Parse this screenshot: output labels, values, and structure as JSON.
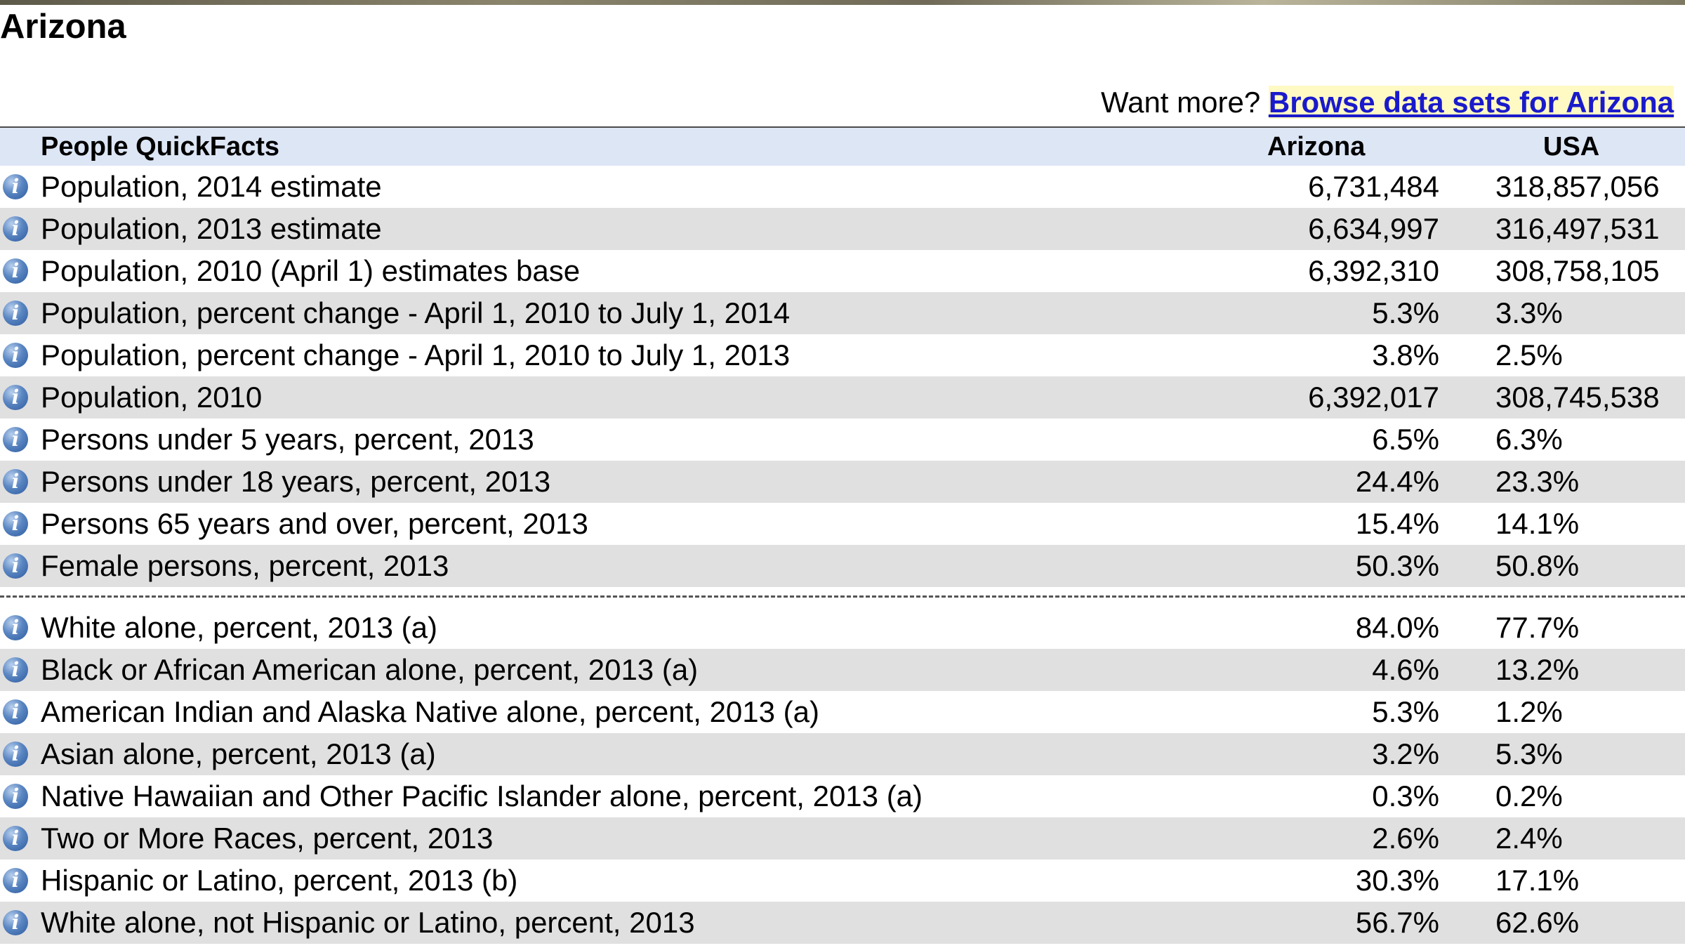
{
  "page": {
    "title": "Arizona",
    "want_more_prefix": "Want more? ",
    "want_more_link": "Browse data sets for Arizona"
  },
  "table": {
    "headers": {
      "label": "People QuickFacts",
      "arizona": "Arizona",
      "usa": "USA"
    },
    "rows_group1": [
      {
        "label": "Population, 2014 estimate",
        "arizona": "6,731,484",
        "usa": "318,857,056"
      },
      {
        "label": "Population, 2013 estimate",
        "arizona": "6,634,997",
        "usa": "316,497,531"
      },
      {
        "label": "Population, 2010 (April 1) estimates base",
        "arizona": "6,392,310",
        "usa": "308,758,105"
      },
      {
        "label": "Population, percent change - April 1, 2010 to July 1, 2014",
        "arizona": "5.3%",
        "usa": "3.3%"
      },
      {
        "label": "Population, percent change - April 1, 2010 to July 1, 2013",
        "arizona": "3.8%",
        "usa": "2.5%"
      },
      {
        "label": "Population, 2010",
        "arizona": "6,392,017",
        "usa": "308,745,538"
      },
      {
        "label": "Persons under 5 years, percent, 2013",
        "arizona": "6.5%",
        "usa": "6.3%"
      },
      {
        "label": "Persons under 18 years, percent, 2013",
        "arizona": "24.4%",
        "usa": "23.3%"
      },
      {
        "label": "Persons 65 years and over, percent, 2013",
        "arizona": "15.4%",
        "usa": "14.1%"
      },
      {
        "label": "Female persons, percent, 2013",
        "arizona": "50.3%",
        "usa": "50.8%"
      }
    ],
    "rows_group2": [
      {
        "label": "White alone, percent, 2013 (a)",
        "arizona": "84.0%",
        "usa": "77.7%"
      },
      {
        "label": "Black or African American alone, percent, 2013 (a)",
        "arizona": "4.6%",
        "usa": "13.2%"
      },
      {
        "label": "American Indian and Alaska Native alone, percent, 2013 (a)",
        "arizona": "5.3%",
        "usa": "1.2%"
      },
      {
        "label": "Asian alone, percent, 2013 (a)",
        "arizona": "3.2%",
        "usa": "5.3%"
      },
      {
        "label": "Native Hawaiian and Other Pacific Islander alone, percent, 2013 (a)",
        "arizona": "0.3%",
        "usa": "0.2%"
      },
      {
        "label": "Two or More Races, percent, 2013",
        "arizona": "2.6%",
        "usa": "2.4%"
      },
      {
        "label": "Hispanic or Latino, percent, 2013 (b)",
        "arizona": "30.3%",
        "usa": "17.1%"
      },
      {
        "label": "White alone, not Hispanic or Latino, percent, 2013",
        "arizona": "56.7%",
        "usa": "62.6%"
      }
    ],
    "info_icon_glyph": "i"
  },
  "colors": {
    "header_bg": "#dde6f5",
    "shaded_row": "#e0e0e0",
    "link": "#1a1acc",
    "link_highlight": "#fff9c4",
    "info_icon": "#3d6bb0"
  },
  "icons": {
    "row_info": "info-icon"
  }
}
